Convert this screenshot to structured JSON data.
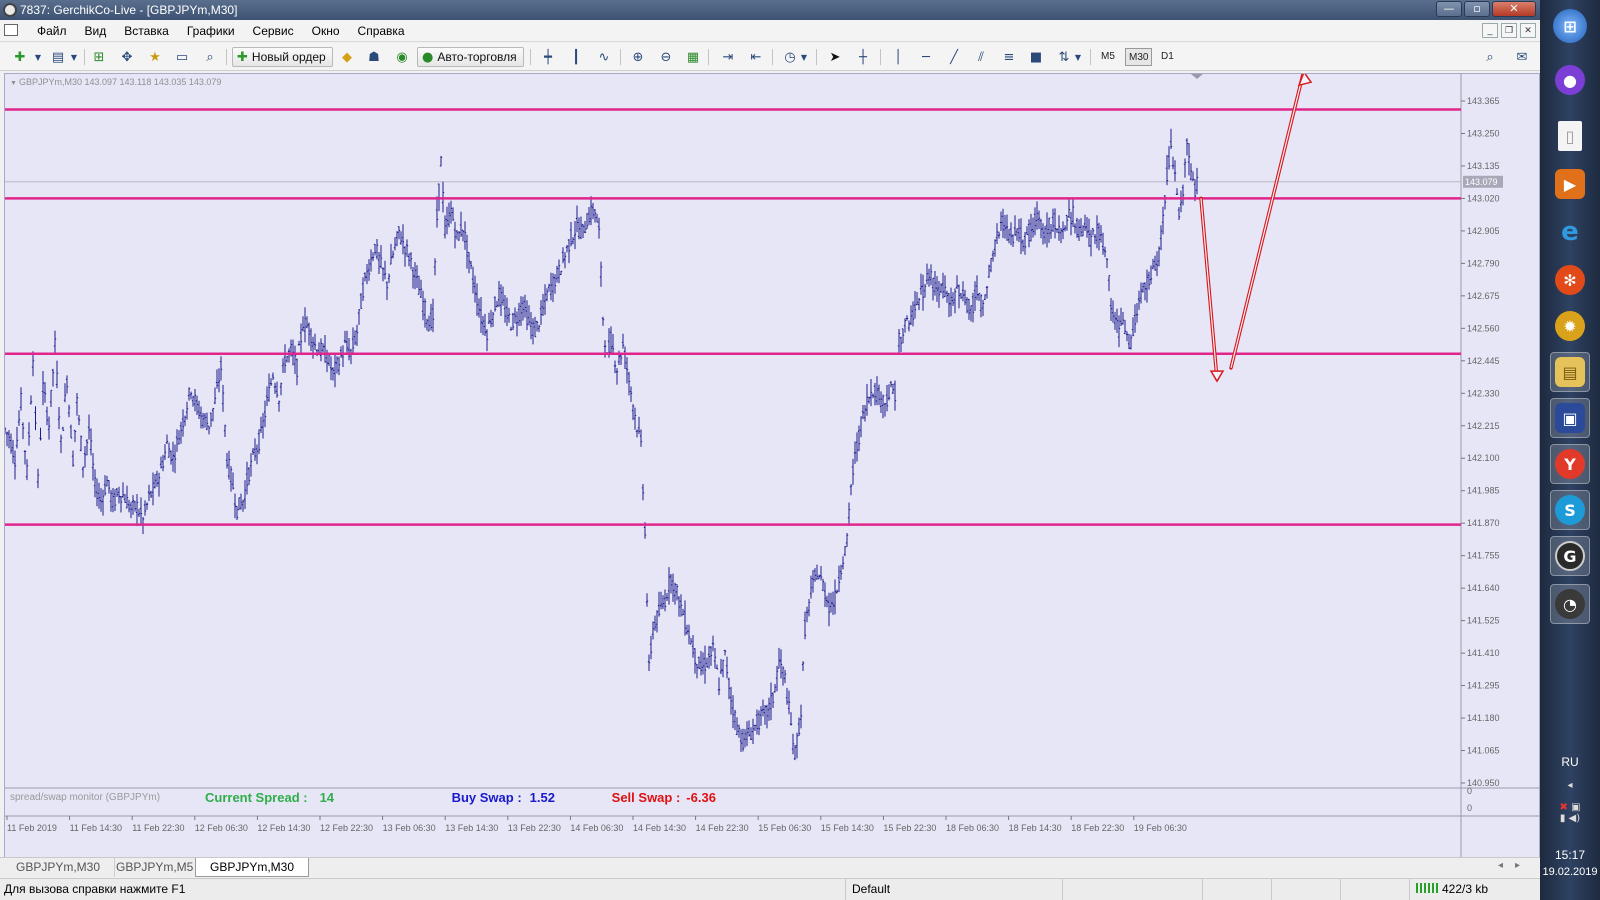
{
  "window": {
    "title": "7837: GerchikCo-Live - [GBPJPYm,M30]",
    "minimize": "—",
    "maximize": "▫",
    "close": "✕"
  },
  "menu": [
    "Файл",
    "Вид",
    "Вставка",
    "Графики",
    "Сервис",
    "Окно",
    "Справка"
  ],
  "toolbar": {
    "new_order": "Новый ордер",
    "autotrade": "Авто-торговля",
    "timeframes": [
      "M5",
      "M30",
      "D1"
    ],
    "active_timeframe": "M30"
  },
  "chart_info": "GBPJPYm,M30  143.097 143.118 143.035 143.079",
  "chart_data": {
    "type": "bar",
    "symbol": "GBPJPYm",
    "timeframe": "M30",
    "ohlc_last": {
      "open": 143.097,
      "high": 143.118,
      "low": 143.035,
      "close": 143.079
    },
    "current_price": "143.079",
    "y_ticks": [
      "143.365",
      "143.250",
      "143.135",
      "143.020",
      "142.905",
      "142.790",
      "142.675",
      "142.560",
      "142.445",
      "142.330",
      "142.215",
      "142.100",
      "141.985",
      "141.870",
      "141.755",
      "141.640",
      "141.525",
      "141.410",
      "141.295",
      "141.180",
      "141.065",
      "140.950"
    ],
    "ylim": [
      140.95,
      143.365
    ],
    "x_ticks": [
      "11 Feb 2019",
      "11 Feb 14:30",
      "11 Feb 22:30",
      "12 Feb 06:30",
      "12 Feb 14:30",
      "12 Feb 22:30",
      "13 Feb 06:30",
      "13 Feb 14:30",
      "13 Feb 22:30",
      "14 Feb 06:30",
      "14 Feb 14:30",
      "14 Feb 22:30",
      "15 Feb 06:30",
      "15 Feb 14:30",
      "15 Feb 22:30",
      "18 Feb 06:30",
      "18 Feb 14:30",
      "18 Feb 22:30",
      "19 Feb 06:30"
    ],
    "horizontal_levels": [
      143.335,
      143.02,
      142.47,
      141.865
    ],
    "line_color": "#e0268c",
    "bar_color": "#1c1c8c",
    "arrow_color": "#d91a1a",
    "price_path": [
      [
        0,
        142.2
      ],
      [
        4,
        142.18
      ],
      [
        10,
        142.1
      ],
      [
        16,
        142.3
      ],
      [
        22,
        142.05
      ],
      [
        28,
        142.45
      ],
      [
        33,
        142.02
      ],
      [
        38,
        142.35
      ],
      [
        44,
        142.22
      ],
      [
        50,
        142.5
      ],
      [
        56,
        142.15
      ],
      [
        62,
        142.38
      ],
      [
        68,
        142.1
      ],
      [
        72,
        142.3
      ],
      [
        78,
        142.08
      ],
      [
        84,
        142.2
      ],
      [
        90,
        142.0
      ],
      [
        96,
        141.95
      ],
      [
        102,
        142.02
      ],
      [
        108,
        141.94
      ],
      [
        114,
        141.98
      ],
      [
        120,
        141.96
      ],
      [
        126,
        141.92
      ],
      [
        132,
        141.93
      ],
      [
        138,
        141.88
      ],
      [
        144,
        141.96
      ],
      [
        150,
        142.0
      ],
      [
        156,
        142.06
      ],
      [
        162,
        142.15
      ],
      [
        168,
        142.1
      ],
      [
        174,
        142.18
      ],
      [
        180,
        142.26
      ],
      [
        186,
        142.35
      ],
      [
        192,
        142.28
      ],
      [
        198,
        142.24
      ],
      [
        204,
        142.22
      ],
      [
        210,
        142.3
      ],
      [
        216,
        142.42
      ],
      [
        222,
        142.1
      ],
      [
        228,
        142.0
      ],
      [
        232,
        141.92
      ],
      [
        238,
        141.95
      ],
      [
        244,
        142.05
      ],
      [
        250,
        142.12
      ],
      [
        256,
        142.18
      ],
      [
        262,
        142.3
      ],
      [
        268,
        142.4
      ],
      [
        274,
        142.32
      ],
      [
        280,
        142.45
      ],
      [
        286,
        142.48
      ],
      [
        292,
        142.42
      ],
      [
        298,
        142.58
      ],
      [
        304,
        142.56
      ],
      [
        310,
        142.5
      ],
      [
        316,
        142.48
      ],
      [
        322,
        142.46
      ],
      [
        328,
        142.4
      ],
      [
        334,
        142.44
      ],
      [
        340,
        142.5
      ],
      [
        346,
        142.47
      ],
      [
        352,
        142.55
      ],
      [
        358,
        142.7
      ],
      [
        364,
        142.78
      ],
      [
        370,
        142.85
      ],
      [
        376,
        142.78
      ],
      [
        382,
        142.72
      ],
      [
        388,
        142.82
      ],
      [
        394,
        142.9
      ],
      [
        400,
        142.85
      ],
      [
        406,
        142.8
      ],
      [
        412,
        142.72
      ],
      [
        418,
        142.65
      ],
      [
        424,
        142.58
      ],
      [
        428,
        142.6
      ],
      [
        432,
        142.95
      ],
      [
        436,
        143.15
      ],
      [
        440,
        142.9
      ],
      [
        446,
        142.98
      ],
      [
        452,
        142.88
      ],
      [
        458,
        142.92
      ],
      [
        464,
        142.8
      ],
      [
        470,
        142.7
      ],
      [
        476,
        142.6
      ],
      [
        482,
        142.55
      ],
      [
        488,
        142.62
      ],
      [
        494,
        142.68
      ],
      [
        500,
        142.62
      ],
      [
        506,
        142.58
      ],
      [
        512,
        142.6
      ],
      [
        518,
        142.65
      ],
      [
        524,
        142.58
      ],
      [
        530,
        142.55
      ],
      [
        536,
        142.6
      ],
      [
        542,
        142.68
      ],
      [
        548,
        142.72
      ],
      [
        554,
        142.76
      ],
      [
        560,
        142.82
      ],
      [
        566,
        142.88
      ],
      [
        572,
        142.92
      ],
      [
        578,
        142.9
      ],
      [
        584,
        142.96
      ],
      [
        590,
        142.98
      ],
      [
        594,
        142.9
      ],
      [
        598,
        142.6
      ],
      [
        602,
        142.45
      ],
      [
        606,
        142.52
      ],
      [
        612,
        142.42
      ],
      [
        618,
        142.5
      ],
      [
        624,
        142.38
      ],
      [
        630,
        142.25
      ],
      [
        636,
        142.15
      ],
      [
        640,
        141.85
      ],
      [
        644,
        141.35
      ],
      [
        648,
        141.5
      ],
      [
        654,
        141.55
      ],
      [
        660,
        141.6
      ],
      [
        666,
        141.68
      ],
      [
        672,
        141.62
      ],
      [
        678,
        141.55
      ],
      [
        684,
        141.48
      ],
      [
        690,
        141.4
      ],
      [
        696,
        141.35
      ],
      [
        702,
        141.38
      ],
      [
        708,
        141.42
      ],
      [
        714,
        141.3
      ],
      [
        720,
        141.4
      ],
      [
        726,
        141.25
      ],
      [
        732,
        141.15
      ],
      [
        738,
        141.1
      ],
      [
        744,
        141.12
      ],
      [
        750,
        141.15
      ],
      [
        756,
        141.18
      ],
      [
        762,
        141.2
      ],
      [
        768,
        141.25
      ],
      [
        774,
        141.38
      ],
      [
        780,
        141.32
      ],
      [
        786,
        141.15
      ],
      [
        790,
        141.05
      ],
      [
        796,
        141.2
      ],
      [
        800,
        141.5
      ],
      [
        806,
        141.62
      ],
      [
        812,
        141.7
      ],
      [
        818,
        141.65
      ],
      [
        824,
        141.58
      ],
      [
        830,
        141.6
      ],
      [
        836,
        141.72
      ],
      [
        842,
        141.8
      ],
      [
        846,
        142.0
      ],
      [
        850,
        142.1
      ],
      [
        856,
        142.22
      ],
      [
        862,
        142.3
      ],
      [
        868,
        142.35
      ],
      [
        874,
        142.32
      ],
      [
        880,
        142.3
      ],
      [
        886,
        142.34
      ],
      [
        892,
        142.33
      ]
    ],
    "price_path_2": [
      [
        894,
        142.52
      ],
      [
        900,
        142.56
      ],
      [
        906,
        142.6
      ],
      [
        912,
        142.66
      ],
      [
        918,
        142.7
      ],
      [
        924,
        142.76
      ],
      [
        930,
        142.72
      ],
      [
        936,
        142.7
      ],
      [
        942,
        142.68
      ],
      [
        948,
        142.66
      ],
      [
        954,
        142.7
      ],
      [
        960,
        142.66
      ],
      [
        966,
        142.62
      ],
      [
        972,
        142.7
      ],
      [
        978,
        142.62
      ],
      [
        984,
        142.75
      ],
      [
        990,
        142.85
      ],
      [
        996,
        142.95
      ],
      [
        1002,
        142.9
      ],
      [
        1008,
        142.88
      ],
      [
        1014,
        142.9
      ],
      [
        1020,
        142.86
      ],
      [
        1026,
        142.92
      ],
      [
        1032,
        142.95
      ],
      [
        1038,
        142.9
      ],
      [
        1044,
        142.92
      ],
      [
        1050,
        142.94
      ],
      [
        1056,
        142.92
      ],
      [
        1062,
        142.95
      ],
      [
        1068,
        142.96
      ],
      [
        1074,
        142.9
      ],
      [
        1080,
        142.92
      ],
      [
        1086,
        142.88
      ],
      [
        1092,
        142.9
      ],
      [
        1098,
        142.86
      ],
      [
        1102,
        142.8
      ],
      [
        1106,
        142.65
      ],
      [
        1110,
        142.58
      ],
      [
        1114,
        142.55
      ],
      [
        1118,
        142.6
      ],
      [
        1122,
        142.52
      ],
      [
        1126,
        142.5
      ],
      [
        1130,
        142.6
      ],
      [
        1136,
        142.68
      ],
      [
        1142,
        142.72
      ],
      [
        1148,
        142.75
      ],
      [
        1154,
        142.82
      ],
      [
        1158,
        142.95
      ],
      [
        1162,
        143.1
      ],
      [
        1166,
        143.2
      ],
      [
        1170,
        143.1
      ],
      [
        1174,
        142.95
      ],
      [
        1178,
        143.05
      ],
      [
        1182,
        143.2
      ],
      [
        1186,
        143.1
      ],
      [
        1190,
        143.05
      ],
      [
        1194,
        143.08
      ]
    ],
    "arrow_path": [
      [
        1196,
        143.02
      ],
      [
        1212,
        142.38
      ],
      [
        1226,
        142.42
      ],
      [
        1298,
        143.46
      ]
    ]
  },
  "spread_panel": {
    "label": "spread/swap monitor (GBPJPYm)",
    "spread_label": "Current Spread :",
    "spread_value": "14",
    "buy_label": "Buy Swap :",
    "buy_value": "1.52",
    "sell_label": "Sell Swap :",
    "sell_value": "-6.36",
    "scale_top": "0",
    "scale_bottom": "0"
  },
  "tabs": [
    "GBPJPYm,M30",
    "GBPJPYm,M5",
    "GBPJPYm,M30"
  ],
  "active_tab_index": 2,
  "status": {
    "help": "Для вызова справки нажмите F1",
    "profile": "Default",
    "traffic": "422/3 kb"
  },
  "taskbar": {
    "lang": "RU",
    "time": "15:17",
    "date": "19.02.2019"
  }
}
